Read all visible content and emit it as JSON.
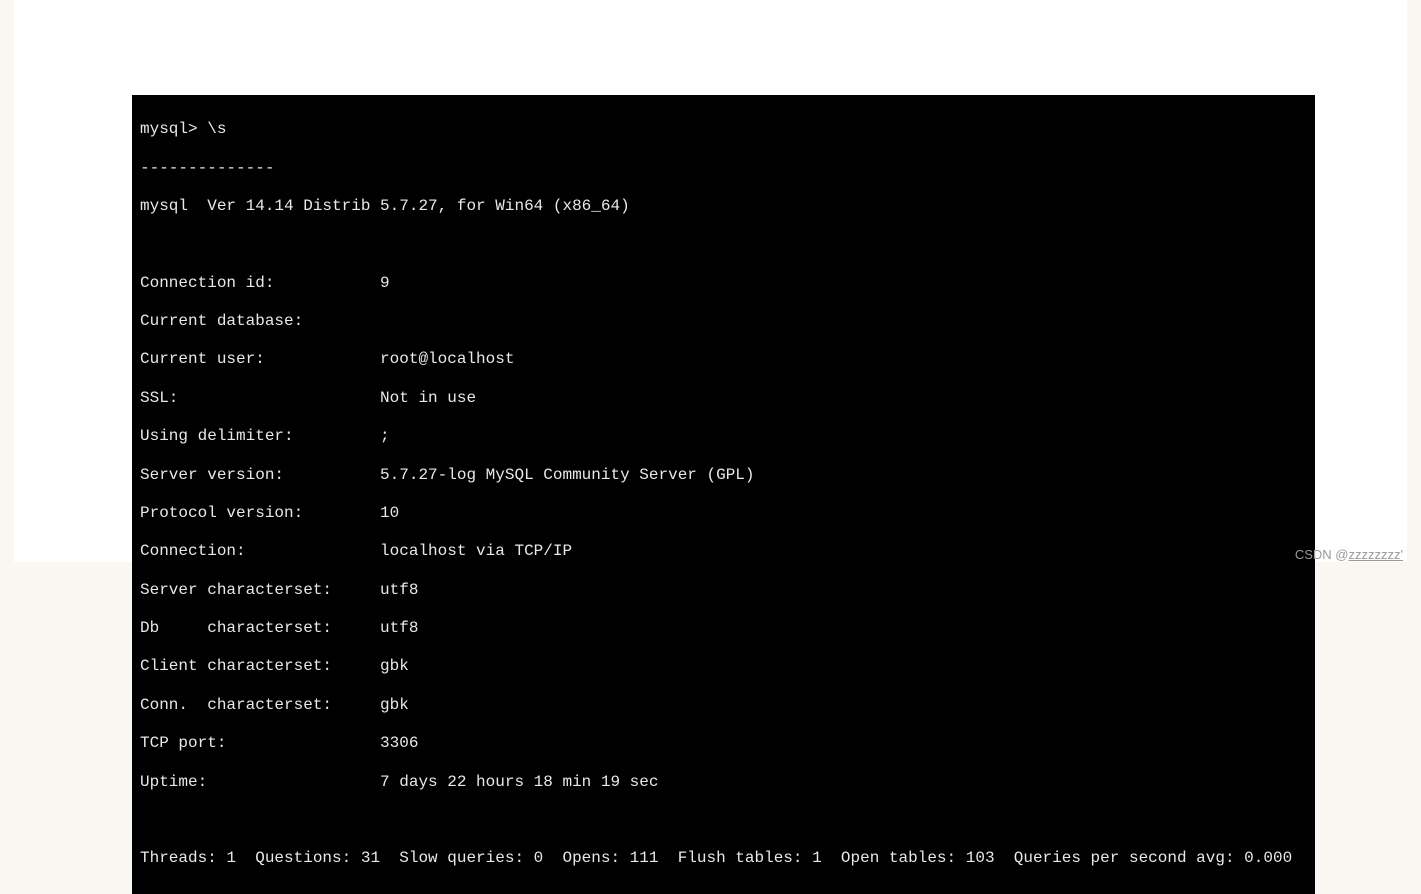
{
  "terminal": {
    "prompt": "mysql> \\s",
    "divider": "--------------",
    "version_line": "mysql  Ver 14.14 Distrib 5.7.27, for Win64 (x86_64)",
    "rows": [
      {
        "label": "Connection id:",
        "value": "9"
      },
      {
        "label": "Current database:",
        "value": ""
      },
      {
        "label": "Current user:",
        "value": "root@localhost"
      },
      {
        "label": "SSL:",
        "value": "Not in use"
      },
      {
        "label": "Using delimiter:",
        "value": ";"
      },
      {
        "label": "Server version:",
        "value": "5.7.27-log MySQL Community Server (GPL)"
      },
      {
        "label": "Protocol version:",
        "value": "10"
      },
      {
        "label": "Connection:",
        "value": "localhost via TCP/IP"
      },
      {
        "label": "Server characterset:",
        "value": "utf8"
      },
      {
        "label": "Db     characterset:",
        "value": "utf8"
      },
      {
        "label": "Client characterset:",
        "value": "gbk"
      },
      {
        "label": "Conn.  characterset:",
        "value": "gbk"
      },
      {
        "label": "TCP port:",
        "value": "3306"
      },
      {
        "label": "Uptime:",
        "value": "7 days 22 hours 18 min 19 sec"
      }
    ],
    "stats_line": "Threads: 1  Questions: 31  Slow queries: 0  Opens: 111  Flush tables: 1  Open tables: 103  Queries per second avg: 0.000"
  },
  "watermark": {
    "prefix": "CSDN @",
    "user": "zzzzzzzz'"
  }
}
